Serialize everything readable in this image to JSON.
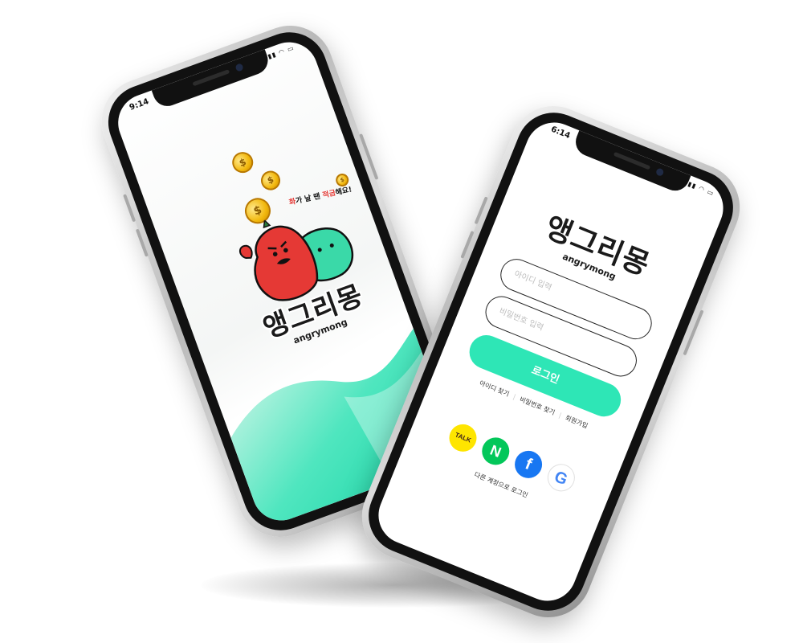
{
  "splash": {
    "status_time": "9:14",
    "tagline_prefix": "화",
    "tagline_mid": "가 날 땐 ",
    "tagline_accent": "적금",
    "tagline_suffix": "해요!",
    "coin_symbol": "$",
    "logo_korean": "앵그리몽",
    "logo_english": "angrymong",
    "colors": {
      "accent": "#2ee6b6",
      "mascot_red": "#e53935",
      "mascot_green": "#3ad9a8",
      "coin": "#f2b80d"
    }
  },
  "login": {
    "status_time": "6:14",
    "logo_korean": "앵그리몽",
    "logo_english": "angrymong",
    "id_placeholder": "아이디 입력",
    "password_placeholder": "비밀번호 입력",
    "login_button": "로그인",
    "links": {
      "find_id": "아이디 찾기",
      "find_password": "비밀번호 찾기",
      "signup": "회원가입"
    },
    "social": {
      "kakao": "TALK",
      "naver": "N",
      "facebook": "f",
      "google": "G"
    },
    "social_caption": "다른 계정으로 로그인",
    "colors": {
      "accent": "#2ee6b6",
      "kakao": "#fee500",
      "naver": "#03c75a",
      "facebook": "#1877f2"
    }
  }
}
